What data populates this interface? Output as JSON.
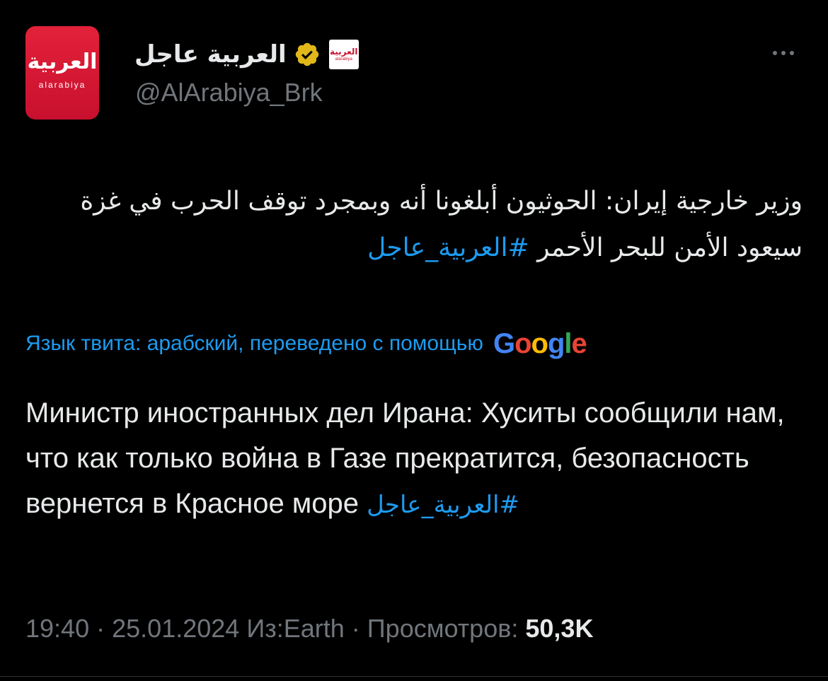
{
  "tweet": {
    "author": {
      "display_name": "العربية عاجل",
      "handle": "@AlArabiya_Brk",
      "avatar_text_ar": "العربية",
      "avatar_text_lat": "alarabiya",
      "badge_logo_ar": "العربية",
      "badge_logo_lat": "alarabiya"
    },
    "text_ar": "وزير خارجية إيران: الحوثيون أبلغونا أنه وبمجرد توقف الحرب في غزة سيعود الأمن للبحر الأحمر",
    "hashtag": "#العربية_عاجل",
    "translation_note": "Язык твита: арабский, переведено с помощью",
    "translation_provider": "Google",
    "translated_text": "Министр иностранных дел Ирана: Хуситы сообщили нам, что как только война в Газе прекратится, безопасность вернется в Красное море",
    "time": "19:40",
    "date": "25.01.2024",
    "source": "Из:Earth",
    "views_label": "Просмотров:",
    "views_count": "50,3K",
    "separator": "·"
  },
  "icons": {
    "verified": "verified-badge-icon",
    "more": "more-options-icon"
  },
  "colors": {
    "background": "#000000",
    "text_primary": "#e7e9ea",
    "text_secondary": "#71767b",
    "link": "#1d9bf0",
    "brand_red": "#c8102e",
    "verified_gold": "#e2b719",
    "google_blue": "#4285F4",
    "google_red": "#EA4335",
    "google_yellow": "#FBBC05",
    "google_green": "#34A853"
  }
}
